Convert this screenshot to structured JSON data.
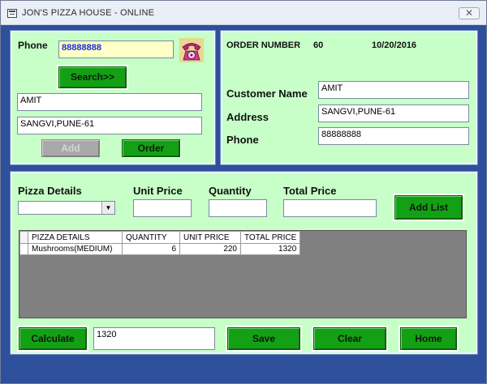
{
  "window": {
    "title": "JON'S PIZZA HOUSE - ONLINE",
    "close_label": "✕"
  },
  "search_panel": {
    "phone_label": "Phone",
    "phone_value": "88888888",
    "search_label": "Search>>",
    "name_value": "AMIT",
    "address_value": "SANGVI,PUNE-61",
    "add_label": "Add",
    "order_label": "Order"
  },
  "order_panel": {
    "order_number_label": "ORDER NUMBER",
    "order_number": "60",
    "date": "10/20/2016",
    "customer_name_label": "Customer Name",
    "customer_name": "AMIT",
    "address_label": "Address",
    "address": "SANGVI,PUNE-61",
    "phone_label": "Phone",
    "phone": "88888888"
  },
  "items_panel": {
    "pizza_details_label": "Pizza Details",
    "unit_price_label": "Unit Price",
    "quantity_label": "Quantity",
    "total_price_label": "Total Price",
    "pizza_select_value": "",
    "unit_price_value": "",
    "quantity_value": "",
    "total_price_value": "",
    "add_list_label": "Add List",
    "table": {
      "columns": [
        "PIZZA DETAILS",
        "QUANTITY",
        "UNIT PRICE",
        "TOTAL PRICE"
      ],
      "rows": [
        [
          "Mushrooms(MEDIUM)",
          "6",
          "220",
          "1320"
        ]
      ]
    },
    "calculate_label": "Calculate",
    "calculated_total": "1320",
    "save_label": "Save",
    "clear_label": "Clear",
    "home_label": "Home"
  },
  "colors": {
    "panel": "#c8ffc8",
    "button_green": "#14a014",
    "client_background": "#2e4f9b",
    "grid_background": "#808080"
  },
  "icons": {
    "phone": "rotary-telephone-icon",
    "app": "window-app-icon",
    "dropdown": "chevron-down-icon"
  }
}
